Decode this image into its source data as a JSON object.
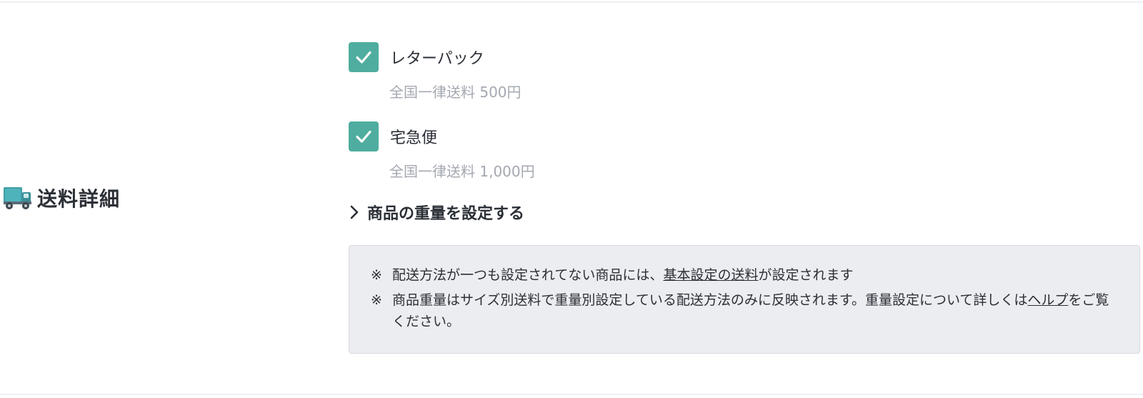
{
  "section": {
    "title": "送料詳細",
    "icon": "truck-icon"
  },
  "shipping_methods": [
    {
      "label": "レターパック",
      "checked": true,
      "fee_text": "全国一律送料 500円"
    },
    {
      "label": "宅急便",
      "checked": true,
      "fee_text": "全国一律送料 1,000円"
    }
  ],
  "weight_toggle": {
    "label": "商品の重量を設定する",
    "icon": "chevron-right-icon"
  },
  "notes": {
    "mark": "※",
    "note1": {
      "before": "配送方法が一つも設定されてない商品には、",
      "link": "基本設定の送料",
      "after": "が設定されます"
    },
    "note2": {
      "before": "商品重量はサイズ別送料で重量別設定している配送方法のみに反映されます。重量設定について詳しくは",
      "link": "ヘルプ",
      "after": "をご覧ください。"
    }
  },
  "colors": {
    "accent": "#4ead9f",
    "notice_bg": "#ecedf1",
    "muted_text": "#a4a8b0"
  }
}
